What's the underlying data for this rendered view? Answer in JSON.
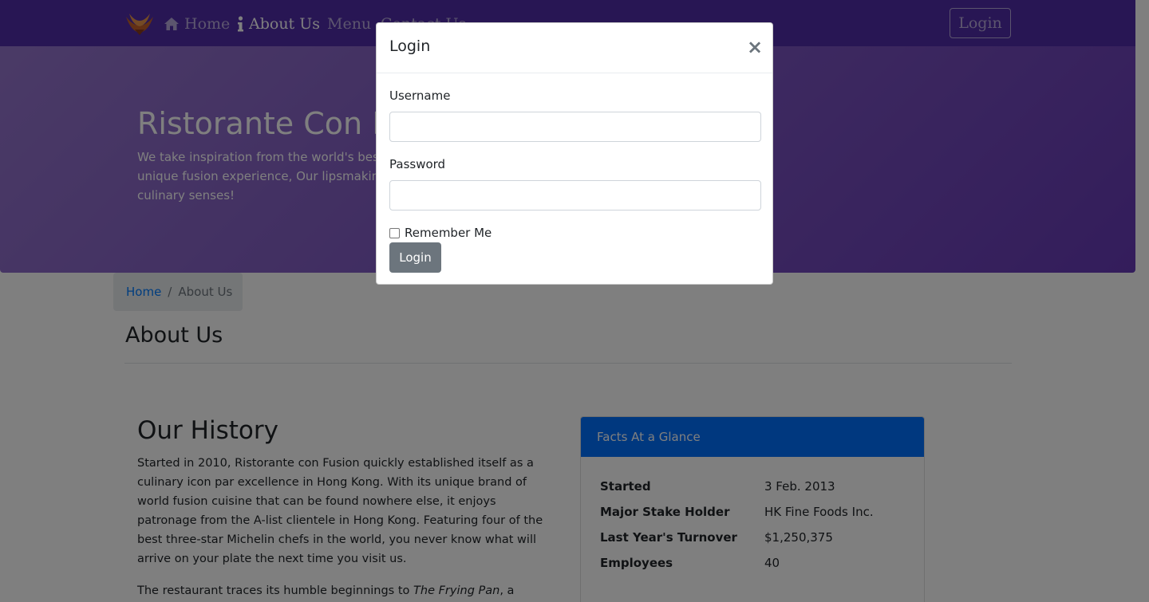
{
  "navbar": {
    "brand_icon": "restaurant-logo",
    "links": [
      {
        "label": "Home",
        "icon": "home-icon"
      },
      {
        "label": "About Us",
        "icon": "info-icon"
      },
      {
        "label": "Menu"
      },
      {
        "label": "Contact Us"
      }
    ],
    "login_label": "Login"
  },
  "jumbotron": {
    "title": "Ristorante Con Fusion",
    "text": "We take inspiration from the world's best cuisines, and create a unique fusion experience, Our lipsmaking creations will tickle your culinary senses!"
  },
  "breadcrumb": {
    "home": "Home",
    "separator": "/",
    "active": "About Us"
  },
  "page": {
    "heading": "About Us",
    "history_title": "Our History",
    "history_p1": "Started in 2010, Ristorante con Fusion quickly established itself as a culinary icon par excellence in Hong Kong. With its unique brand of world fusion cuisine that can be found nowhere else, it enjoys patronage from the A-list clientele in Hong Kong. Featuring four of the best three-star Michelin chefs in the world, you never know what will arrive on your plate the next time you visit us.",
    "history_p2_prefix": "The restaurant traces its humble beginnings to ",
    "history_p2_em": "The Frying Pan",
    "history_p2_suffix": ", a"
  },
  "facts": {
    "header": "Facts At a Glance",
    "rows": [
      {
        "term": "Started",
        "def": "3 Feb. 2013"
      },
      {
        "term": "Major Stake Holder",
        "def": "HK Fine Foods Inc."
      },
      {
        "term": "Last Year's Turnover",
        "def": "$1,250,375"
      },
      {
        "term": "Employees",
        "def": "40"
      }
    ]
  },
  "modal": {
    "title": "Login",
    "close": "×",
    "username_label": "Username",
    "username_value": "",
    "password_label": "Password",
    "password_value": "",
    "remember_label": "Remember Me",
    "submit_label": "Login"
  },
  "colors": {
    "navbar": "#512da8",
    "jumbotron_from": "#9575cd",
    "jumbotron_to": "#673ab7",
    "card_header": "#0070ff",
    "submit_button": "#6c757d"
  }
}
